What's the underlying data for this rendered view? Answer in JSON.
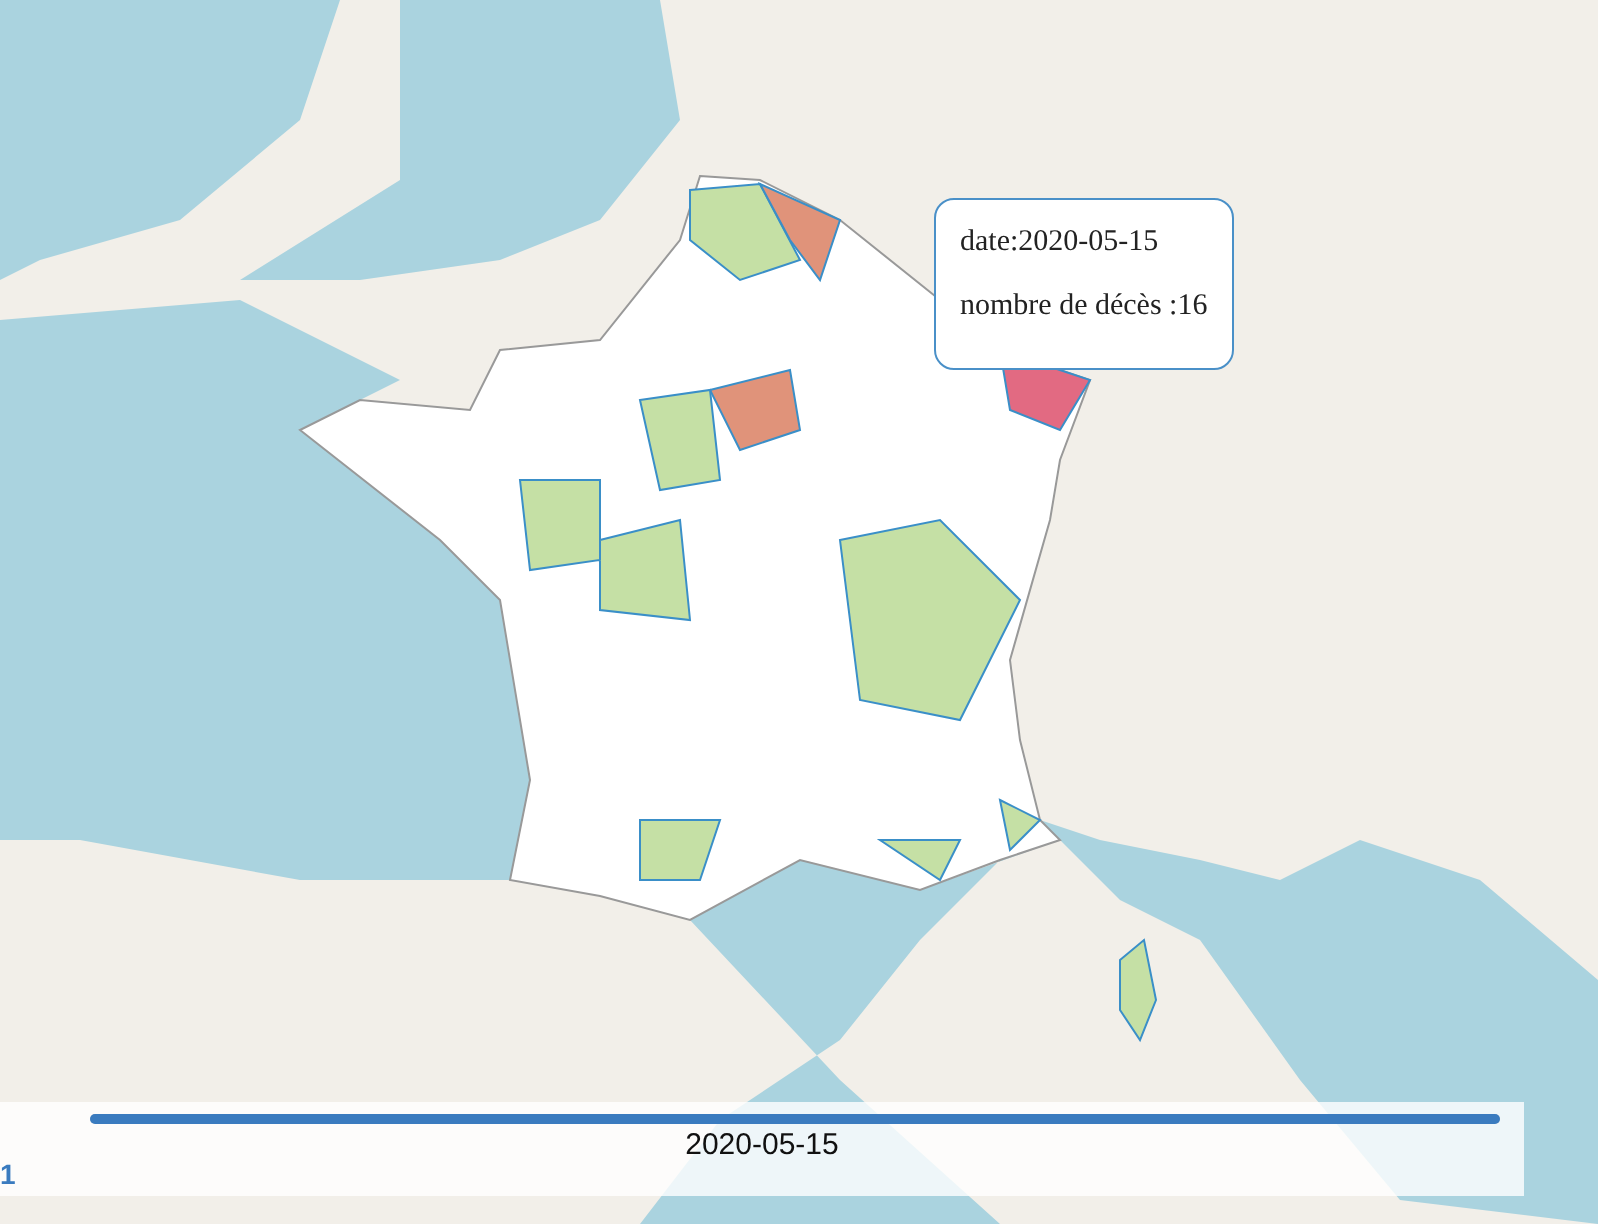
{
  "tooltip": {
    "lines": [
      "date:2020-05-15",
      "nombre de décès :16"
    ]
  },
  "slider": {
    "level": 1,
    "label": "2020-05-15",
    "side_label": "1"
  }
}
